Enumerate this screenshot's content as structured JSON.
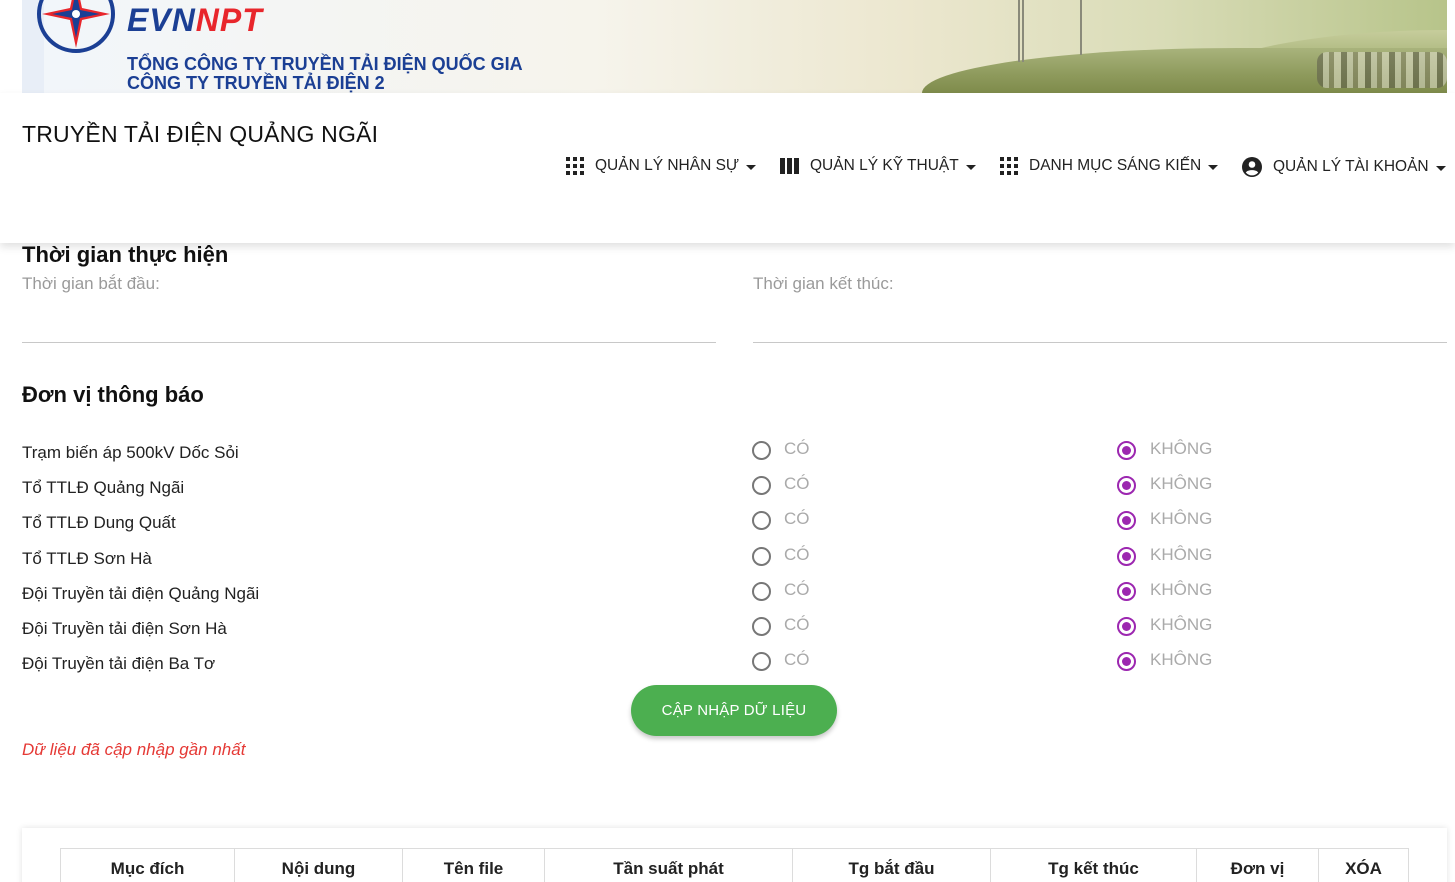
{
  "banner": {
    "brand_evn": "EVN",
    "brand_npt": "NPT",
    "corp_line1": "TỔNG CÔNG TY TRUYỀN TẢI ĐIỆN QUỐC GIA",
    "corp_line2": "CÔNG TY TRUYỀN TẢI ĐIỆN 2"
  },
  "header": {
    "site_title": "TRUYỀN TẢI ĐIỆN QUẢNG NGÃI",
    "nav": [
      {
        "label": "QUẢN LÝ NHÂN SỰ",
        "icon": "grid-icon"
      },
      {
        "label": "QUẢN LÝ KỸ THUẬT",
        "icon": "columns-icon"
      },
      {
        "label": "DANH MỤC SÁNG KIẾN",
        "icon": "grid-icon"
      },
      {
        "label": "QUẢN LÝ TÀI KHOẢN",
        "icon": "account-circle-icon"
      }
    ]
  },
  "time_section": {
    "title": "Thời gian thực hiện",
    "start_label": "Thời gian bắt đầu:",
    "end_label": "Thời gian kết thúc:"
  },
  "unit_section": {
    "title": "Đơn vị thông báo",
    "yes_label": "CÓ",
    "no_label": "KHÔNG",
    "units": [
      {
        "name": "Trạm biến áp 500kV Dốc Sỏi",
        "selected": "KHÔNG"
      },
      {
        "name": "Tổ TTLĐ Quảng Ngãi",
        "selected": "KHÔNG"
      },
      {
        "name": "Tổ TTLĐ Dung Quất",
        "selected": "KHÔNG"
      },
      {
        "name": "Tổ TTLĐ Sơn Hà",
        "selected": "KHÔNG"
      },
      {
        "name": "Đội Truyền tải điện Quảng Ngãi",
        "selected": "KHÔNG"
      },
      {
        "name": "Đội Truyền tải điện Sơn Hà",
        "selected": "KHÔNG"
      },
      {
        "name": "Đội Truyền tải điện Ba Tơ",
        "selected": "KHÔNG"
      }
    ]
  },
  "actions": {
    "update_label": "CẬP NHẬP DỮ LIỆU",
    "last_updated": "Dữ liệu đã cập nhập gần nhất"
  },
  "table": {
    "columns": [
      "Mục đích",
      "Nội dung",
      "Tên file",
      "Tần suất phát",
      "Tg bắt đầu",
      "Tg kết thúc",
      "Đơn vị",
      "XÓA"
    ]
  },
  "colors": {
    "accent_purple": "#9c27b0",
    "button_green": "#4caf50",
    "warning_red": "#e53935",
    "brand_blue": "#1b3f94",
    "brand_red": "#e8262c"
  }
}
